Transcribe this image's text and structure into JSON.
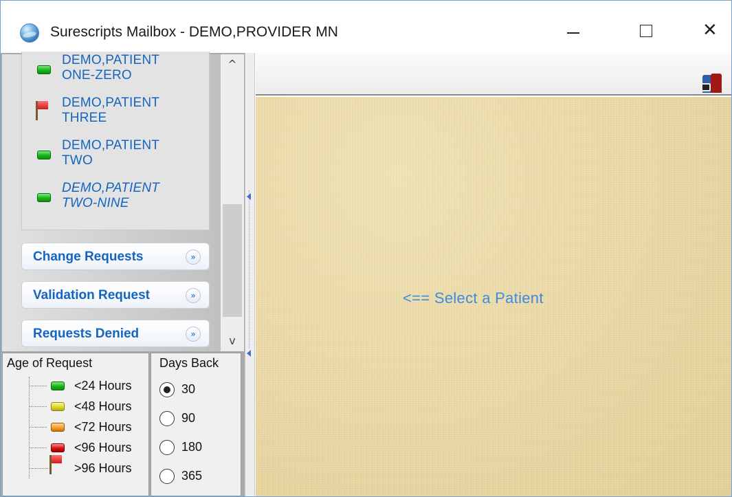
{
  "window": {
    "title": "Surescripts Mailbox - DEMO,PROVIDER MN",
    "controls": {
      "minimize": "—",
      "maximize": "☐",
      "close": "✕"
    }
  },
  "patients": [
    {
      "line1": "DEMO,PATIENT",
      "line2": "ONE-ZERO",
      "status": "green",
      "italic": false
    },
    {
      "line1": "DEMO,PATIENT",
      "line2": "THREE",
      "status": "flag",
      "italic": false
    },
    {
      "line1": "DEMO,PATIENT",
      "line2": "TWO",
      "status": "green",
      "italic": false
    },
    {
      "line1": "DEMO,PATIENT",
      "line2": "TWO-NINE",
      "status": "green",
      "italic": true
    }
  ],
  "sections": [
    {
      "label": "Change Requests",
      "chevron": "»"
    },
    {
      "label": "Validation Request",
      "chevron": "»"
    },
    {
      "label": "Requests Denied",
      "chevron": "»"
    }
  ],
  "scrollbar": {
    "up": "^",
    "down": "v"
  },
  "legend": {
    "heading": "Age of Request",
    "items": [
      {
        "label": "<24 Hours",
        "color": "green"
      },
      {
        "label": "<48 Hours",
        "color": "yellow"
      },
      {
        "label": "<72 Hours",
        "color": "orange"
      },
      {
        "label": "<96 Hours",
        "color": "red"
      },
      {
        "label": ">96 Hours",
        "color": "flag"
      }
    ]
  },
  "days_back": {
    "heading": "Days Back",
    "selected": "30",
    "options": [
      "30",
      "90",
      "180",
      "365"
    ]
  },
  "main": {
    "hint": "<== Select a Patient"
  },
  "colors": {
    "link_blue": "#1565c0",
    "hint_blue": "#3c8ce0",
    "content_bg": "#ecdcaa"
  }
}
